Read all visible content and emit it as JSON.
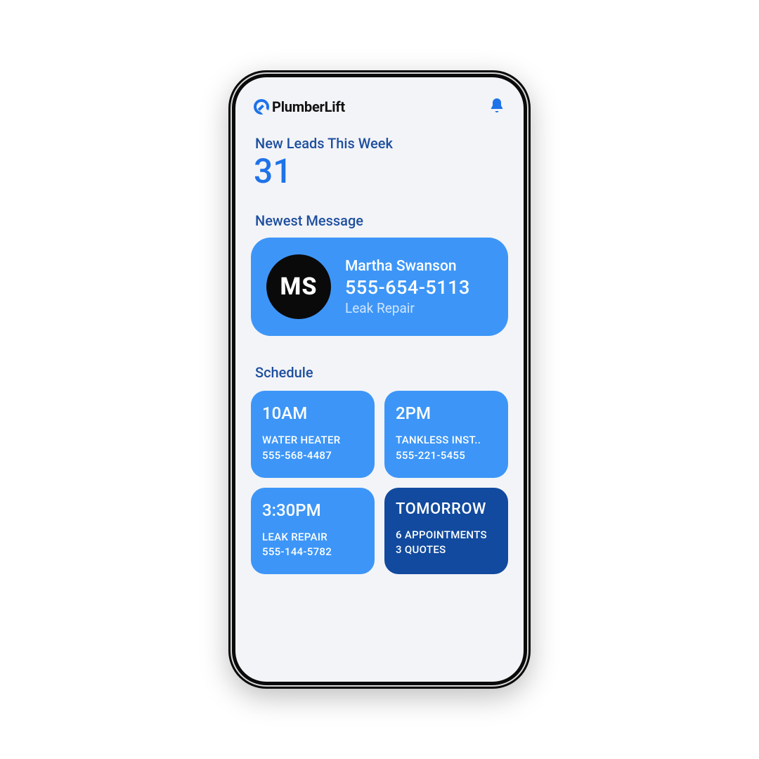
{
  "brand": {
    "name": "PlumberLift"
  },
  "leads": {
    "label": "New Leads This Week",
    "count": "31"
  },
  "message": {
    "label": "Newest Message",
    "initials": "MS",
    "name": "Martha Swanson",
    "phone": "555-654-5113",
    "service": "Leak Repair"
  },
  "schedule": {
    "label": "Schedule",
    "tiles": [
      {
        "time": "10AM",
        "line1": "WATER HEATER",
        "line2": "555-568-4487"
      },
      {
        "time": "2PM",
        "line1": "TANKLESS INST..",
        "line2": "555-221-5455"
      },
      {
        "time": "3:30PM",
        "line1": "LEAK REPAIR",
        "line2": "555-144-5782"
      },
      {
        "time": "TOMORROW",
        "line1": "6 APPOINTMENTS",
        "line2": "3 QUOTES"
      }
    ]
  },
  "colors": {
    "accent": "#3d96f7",
    "accentDark": "#114a9e",
    "brand": "#1e73e8"
  }
}
